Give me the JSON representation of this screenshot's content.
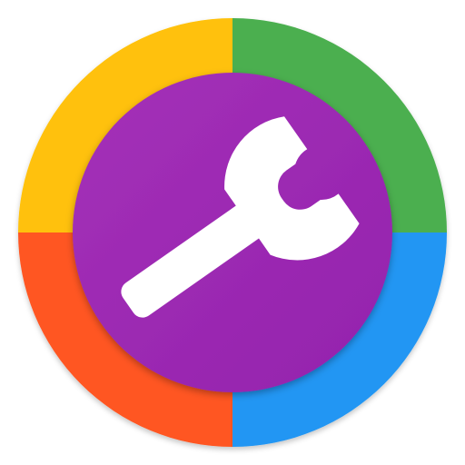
{
  "app_icon": {
    "icon_name": "wrench-icon",
    "colors": {
      "top_left": "#FFC107",
      "top_right": "#4CAF50",
      "bottom_left": "#FF5722",
      "bottom_right": "#2196F3",
      "center": "#9C27B0",
      "wrench": "#FFFFFF"
    }
  }
}
